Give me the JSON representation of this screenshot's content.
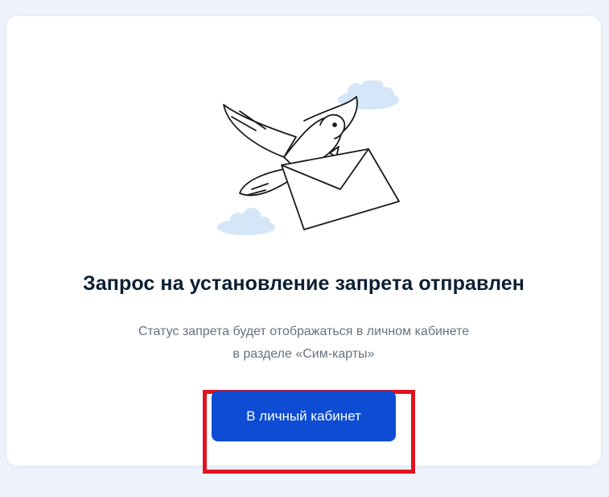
{
  "colors": {
    "page_background": "#edf2fb",
    "card_background": "#ffffff",
    "title": "#0b1f33",
    "subtitle": "#66727f",
    "primary_button": "#0d4cd3",
    "highlight_frame": "#e0141e",
    "cloud": "#d4e6f8"
  },
  "illustration": {
    "icon": "dove-with-envelope-icon"
  },
  "main": {
    "title": "Запрос на установление запрета отправлен",
    "subtitle_line1": "Статус запрета будет отображаться в личном кабинете",
    "subtitle_line2": "в разделе «Сим-карты»",
    "button_label": "В личный кабинет"
  }
}
